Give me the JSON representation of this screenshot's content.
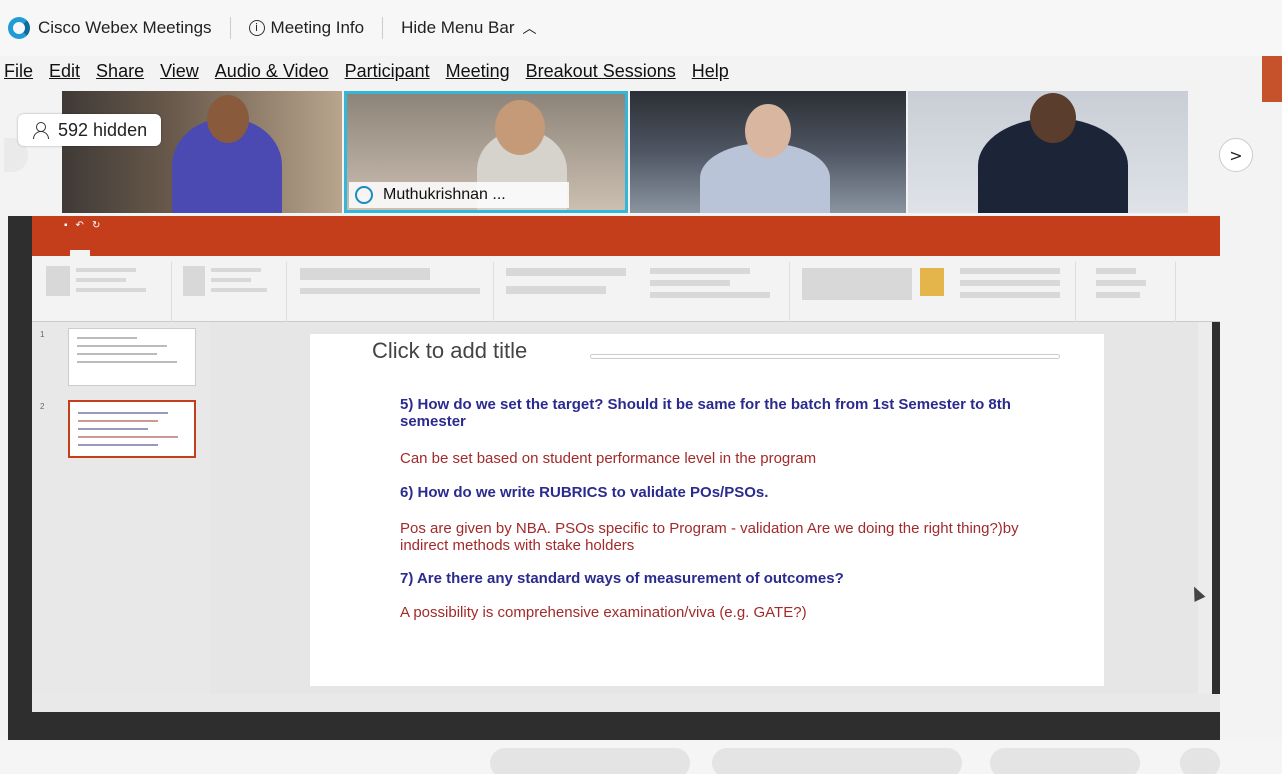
{
  "webex": {
    "app_name": "Cisco Webex Meetings",
    "meeting_info": "Meeting Info",
    "hide_menu_bar": "Hide Menu Bar"
  },
  "menu": [
    {
      "label": "File"
    },
    {
      "label": "Edit"
    },
    {
      "label": "Share"
    },
    {
      "label": "View"
    },
    {
      "label": "Audio & Video"
    },
    {
      "label": "Participant"
    },
    {
      "label": "Meeting"
    },
    {
      "label": "Breakout Sessions"
    },
    {
      "label": "Help"
    }
  ],
  "participants": {
    "hidden_count": "592 hidden",
    "active_speaker": "Muthukrishnan ..."
  },
  "slide": {
    "title_placeholder": "Click to add title",
    "q5": "5) How do we set the target? Should it be same for the batch from 1st Semester to 8th semester",
    "a5": "Can be set based on student performance level in the program",
    "q6": "6) How do we write RUBRICS to validate POs/PSOs.",
    "a6": "Pos are given by NBA. PSOs specific to Program - validation Are we doing the right thing?)by indirect methods with stake holders",
    "q7": "7) Are there any standard ways of measurement of outcomes?",
    "a7": "A possibility is comprehensive examination/viva (e.g. GATE?)"
  },
  "colors": {
    "accent": "#34b6d9",
    "ppt_red": "#c43e1c",
    "question": "#2b2b8f",
    "answer": "#a22a2a"
  }
}
